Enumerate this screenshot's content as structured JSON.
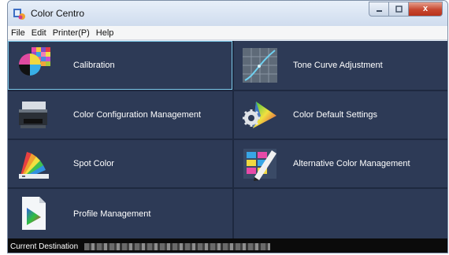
{
  "window": {
    "title": "Color Centro",
    "icon": "color-centro-app-icon",
    "controls": {
      "minimize": "minimize-icon",
      "maximize": "maximize-icon",
      "close_symbol": "x"
    }
  },
  "menu": [
    {
      "label": "File"
    },
    {
      "label": "Edit"
    },
    {
      "label": "Printer(P)"
    },
    {
      "label": "Help"
    }
  ],
  "tiles": [
    {
      "label": "Calibration",
      "icon": "calibration-icon",
      "selected": true
    },
    {
      "label": "Tone Curve Adjustment",
      "icon": "tone-curve-icon",
      "selected": false
    },
    {
      "label": "Color Configuration Management",
      "icon": "printer-config-icon",
      "selected": false
    },
    {
      "label": "Color Default Settings",
      "icon": "color-gear-icon",
      "selected": false
    },
    {
      "label": "Spot Color",
      "icon": "swatch-fan-icon",
      "selected": false
    },
    {
      "label": "Alternative Color Management",
      "icon": "color-pen-icon",
      "selected": false
    },
    {
      "label": "Profile Management",
      "icon": "profile-document-icon",
      "selected": false
    }
  ],
  "status": {
    "label": "Current Destination"
  },
  "colors": {
    "tile_bg": "#2d3a56",
    "grid_gap": "#1e2940",
    "selection_outline": "#7cc8e8",
    "status_bg": "#0b0b0b"
  }
}
